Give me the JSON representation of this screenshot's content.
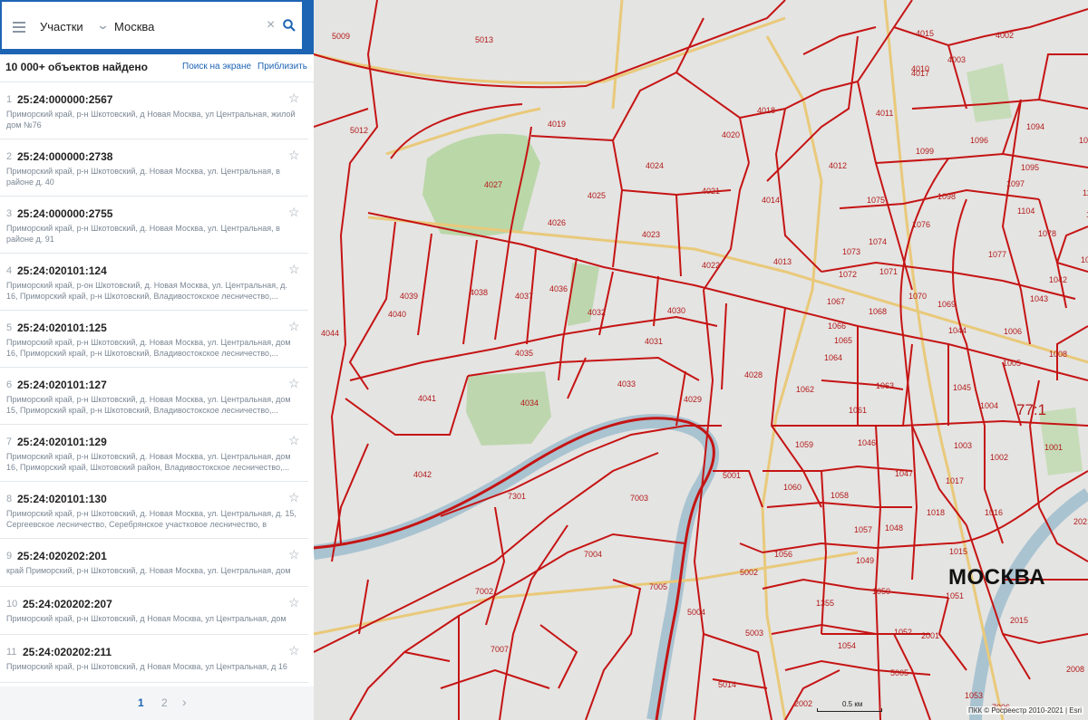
{
  "search": {
    "category": "Участки",
    "query": "Москва"
  },
  "results": {
    "count_label": "10 000+ объектов найдено",
    "link_search_screen": "Поиск на экране",
    "link_zoom": "Приблизить"
  },
  "items": [
    {
      "n": "1",
      "id": "25:24:000000:2567",
      "addr": "Приморский край, р-н Шкотовский, д Новая Москва, ул Центральная, жилой дом №76"
    },
    {
      "n": "2",
      "id": "25:24:000000:2738",
      "addr": "Приморский край, р-н Шкотовский, д. Новая Москва, ул. Центральная, в районе д. 40"
    },
    {
      "n": "3",
      "id": "25:24:000000:2755",
      "addr": "Приморский край, р-н Шкотовский, д. Новая Москва, ул. Центральная, в районе д. 91"
    },
    {
      "n": "4",
      "id": "25:24:020101:124",
      "addr": "Приморский край, р-он Шкотовский, д. Новая Москва, ул. Центральная, д. 16, Приморский край, р-н Шкотовский, Владивостокское лесничество,..."
    },
    {
      "n": "5",
      "id": "25:24:020101:125",
      "addr": "Приморский край, р-н Шкотовский, д. Новая Москва, ул. Центральная, дом 16, Приморский край, р-н Шкотовский, Владивостокское лесничество,..."
    },
    {
      "n": "6",
      "id": "25:24:020101:127",
      "addr": "Приморский край, р-н Шкотовский, д. Новая Москва, ул. Центральная, дом 15, Приморский край, р-н Шкотовский, Владивостокское лесничество,..."
    },
    {
      "n": "7",
      "id": "25:24:020101:129",
      "addr": "Приморский край, р-н Шкотовский, д. Новая Москва, ул. Центральная, дом 16, Приморский край, Шкотовский район, Владивостокское лесничество,..."
    },
    {
      "n": "8",
      "id": "25:24:020101:130",
      "addr": "Приморский край, р-н Шкотовский, д. Новая Москва, ул. Центральная, д. 15, Сергеевское лесничество, Серебрянское участковое лесничество, в части..."
    },
    {
      "n": "9",
      "id": "25:24:020202:201",
      "addr": "край Приморский, р-н Шкотовский, д. Новая Москва, ул. Центральная, дом 121"
    },
    {
      "n": "10",
      "id": "25:24:020202:207",
      "addr": "Приморский край, р-н Шкотовский, д Новая Москва, ул Центральная, дом 16"
    },
    {
      "n": "11",
      "id": "25:24:020202:211",
      "addr": "Приморский край, р-н Шкотовский, д Новая Москва, ул Центральная, д 16"
    }
  ],
  "pagination": {
    "page1": "1",
    "page2": "2"
  },
  "map": {
    "city_label": "МОСКВА",
    "district_label": "77:1",
    "scale_label": "0.5 км",
    "attribution": "ПКК © Росреестр 2010-2021 | Esri",
    "block_labels": [
      "5009",
      "5013",
      "5012",
      "4015",
      "4002",
      "4010",
      "4003",
      "4017",
      "4018",
      "4011",
      "4019",
      "4020",
      "1094",
      "1093",
      "1099",
      "1096",
      "4012",
      "1095",
      "1097",
      "1103",
      "4024",
      "4021",
      "4014",
      "1075",
      "1098",
      "4027",
      "4025",
      "1104",
      "1079",
      "1076",
      "4026",
      "4023",
      "1074",
      "1078",
      "4013",
      "1073",
      "1077",
      "4022",
      "1072",
      "1071",
      "1041",
      "4039",
      "4038",
      "4037",
      "4036",
      "1043",
      "1042",
      "1067",
      "1070",
      "1069",
      "4040",
      "4032",
      "4030",
      "1068",
      "1066",
      "1065",
      "1044",
      "4044",
      "4031",
      "1006",
      "4035",
      "1064",
      "1005",
      "1008",
      "4028",
      "4033",
      "1063",
      "1062",
      "4041",
      "1045",
      "4029",
      "1061",
      "1004",
      "4034",
      "1059",
      "1046",
      "1003",
      "1001",
      "5001",
      "1047",
      "1002",
      "4042",
      "1017",
      "1060",
      "1058",
      "7301",
      "7003",
      "1018",
      "1016",
      "1057",
      "1048",
      "2021",
      "7004",
      "1056",
      "1015",
      "5002",
      "1049",
      "1050",
      "1051",
      "7002",
      "7005",
      "1355",
      "2015",
      "5004",
      "1052",
      "1054",
      "7007",
      "5003",
      "2001",
      "1053",
      "2008",
      "5005",
      "5014",
      "2002",
      "7006"
    ]
  }
}
